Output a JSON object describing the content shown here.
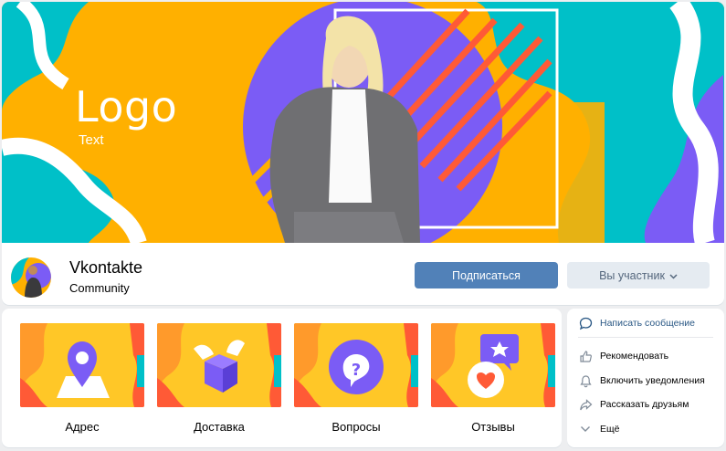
{
  "cover": {
    "logo": "Logo",
    "text": "Text"
  },
  "profile": {
    "name": "Vkontakte",
    "type": "Community",
    "subscribe_label": "Подписаться",
    "member_label": "Вы участник"
  },
  "menu": {
    "items": [
      {
        "label": "Адрес",
        "icon": "location-pin-icon"
      },
      {
        "label": "Доставка",
        "icon": "flying-box-icon"
      },
      {
        "label": "Вопросы",
        "icon": "question-bubble-icon"
      },
      {
        "label": "Отзывы",
        "icon": "review-bubbles-icon"
      }
    ]
  },
  "actions": {
    "write": "Написать сообщение",
    "recommend": "Рекомендовать",
    "notify": "Включить уведомления",
    "share": "Рассказать друзьям",
    "more": "Ещё"
  },
  "colors": {
    "accent": "#5181b8",
    "cover_yellow": "#ffb000",
    "cover_teal": "#00c0c8",
    "cover_purple": "#7b5cf5",
    "stripe_red": "#ff5a36"
  }
}
